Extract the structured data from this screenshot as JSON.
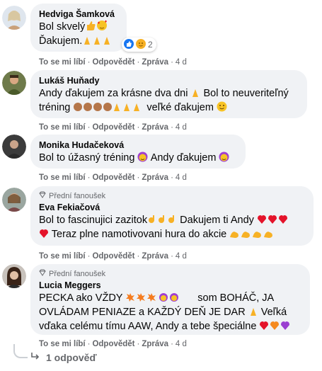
{
  "comments": [
    {
      "author": "Hedviga Šamková",
      "badge": "",
      "lines": [
        "Bol skvelý",
        "Ďakujem."
      ],
      "reaction_count": "2",
      "actions": {
        "like": "To se mi líbí",
        "reply": "Odpovědět",
        "message": "Zpráva",
        "time": "4 d"
      }
    },
    {
      "author": "Lukáš Huňady",
      "badge": "",
      "lines": [
        "Andy ďakujem za krásne dva dni",
        "Bol to neuveriteľný",
        "tréning",
        "veľké ďakujem"
      ],
      "actions": {
        "like": "To se mi líbí",
        "reply": "Odpovědět",
        "message": "Zpráva",
        "time": "4 d"
      }
    },
    {
      "author": "Monika Hudačeková",
      "badge": "",
      "lines": [
        "Bol to úžasný tréning",
        "Andy ďakujem"
      ],
      "actions": {
        "like": "To se mi líbí",
        "reply": "Odpovědět",
        "message": "Zpráva",
        "time": "4 d"
      }
    },
    {
      "author": "Eva Fekiačová",
      "badge": "Přední fanoušek",
      "lines": [
        "Bol to fascinujici zazitok",
        "Dakujem ti Andy",
        "Teraz plne namotivovani hura do akcie"
      ],
      "actions": {
        "like": "To se mi líbí",
        "reply": "Odpovědět",
        "message": "Zpráva",
        "time": "4 d"
      }
    },
    {
      "author": "Lucia Meggers",
      "badge": "Přední fanoušek",
      "lines": [
        "PECKA ako VŽDY",
        "som BOHÁČ, JA",
        "OVLÁDAM PENIAZE a KAŽDÝ DEŇ JE DAR",
        "Veľká",
        "vďaka celému tímu AAW, Andy a tebe špeciálne"
      ],
      "actions": {
        "like": "To se mi líbí",
        "reply": "Odpovědět",
        "message": "Zpráva",
        "time": "4 d"
      }
    }
  ],
  "more_replies": "1 odpověď",
  "colors": {
    "bubble": "#f0f2f5",
    "meta": "#65676b",
    "like_blue": "#1877f2"
  }
}
